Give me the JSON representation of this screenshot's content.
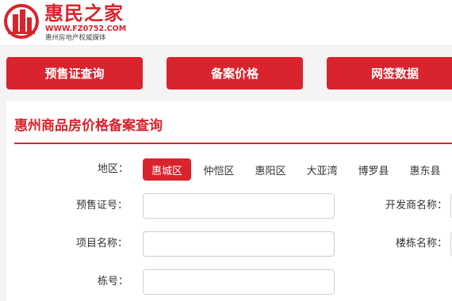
{
  "header": {
    "logo_title": "惠民之家",
    "logo_url": "WWW.FZ0752.COM",
    "logo_tagline": "惠州房地产权威媒体",
    "brand_color": "#d9232d"
  },
  "nav": {
    "presale_label": "预售证查询",
    "price_label": "备案价格",
    "sign_label": "网签数据"
  },
  "panel": {
    "title": "惠州商品房价格备案查询",
    "district_label": "地区：",
    "districts": [
      "惠城区",
      "仲恺区",
      "惠阳区",
      "大亚湾",
      "博罗县",
      "惠东县"
    ],
    "selected_district": "惠城区",
    "presale_label": "预售证号：",
    "developer_label": "开发商名称：",
    "project_label": "项目名称：",
    "building_name_label": "楼栋名称：",
    "building_no_label": "栋号："
  }
}
